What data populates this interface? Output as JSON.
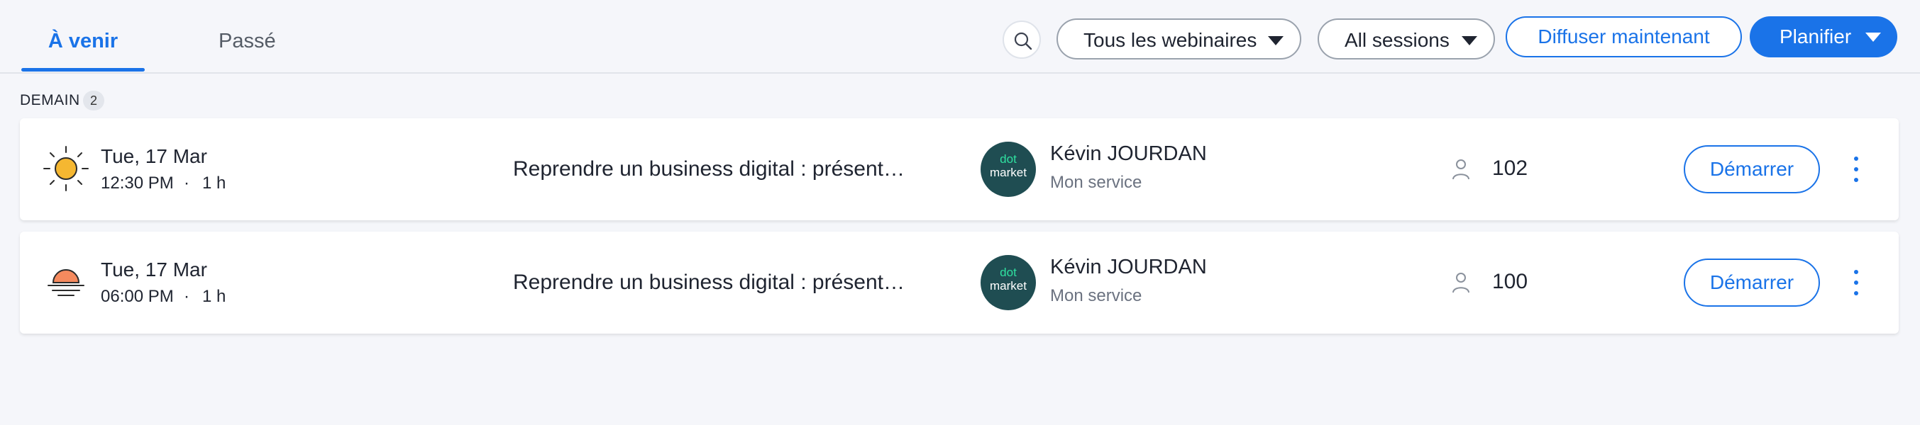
{
  "tabs": [
    {
      "label": "À venir",
      "active": true
    },
    {
      "label": "Passé",
      "active": false
    }
  ],
  "toolbar": {
    "search_icon": "search-icon",
    "filter_webinars": "Tous les webinaires",
    "filter_sessions": "All sessions",
    "broadcast_now": "Diffuser maintenant",
    "schedule": "Planifier"
  },
  "section": {
    "label": "DEMAIN",
    "count": "2"
  },
  "sessions": [
    {
      "weather_icon": "sun-icon",
      "date": "Tue, 17 Mar",
      "time": "12:30 PM",
      "separator": "·",
      "duration": "1 h",
      "title": "Reprendre un business digital : présent…",
      "avatar_line1": "dot",
      "avatar_line2": "market",
      "host": "Kévin JOURDAN",
      "host_sub": "Mon service",
      "attendees": "102",
      "start_label": "Démarrer"
    },
    {
      "weather_icon": "sunset-icon",
      "date": "Tue, 17 Mar",
      "time": "06:00 PM",
      "separator": "·",
      "duration": "1 h",
      "title": "Reprendre un business digital : présent…",
      "avatar_line1": "dot",
      "avatar_line2": "market",
      "host": "Kévin JOURDAN",
      "host_sub": "Mon service",
      "attendees": "100",
      "start_label": "Démarrer"
    }
  ],
  "colors": {
    "accent": "#1a73e8",
    "avatar_bg": "#1f4d52",
    "avatar_dot": "#2fe1a0",
    "sun": "#f5b731"
  }
}
